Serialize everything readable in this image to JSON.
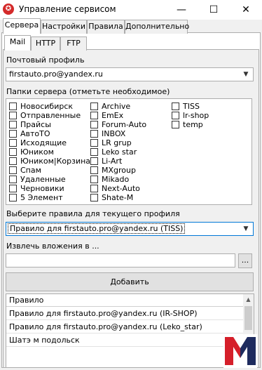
{
  "window": {
    "app_icon_glyph": "✪",
    "title": "Управление сервисом",
    "minimize_glyph": "—",
    "maximize_glyph": "☐",
    "close_glyph": "✕"
  },
  "main_tabs": [
    {
      "label": "Сервера"
    },
    {
      "label": "Настройки"
    },
    {
      "label": "Правила"
    },
    {
      "label": "Дополнительно"
    }
  ],
  "sub_tabs": [
    {
      "label": "Mail"
    },
    {
      "label": "HTTP"
    },
    {
      "label": "FTP"
    }
  ],
  "mail": {
    "profile_label": "Почтовый профиль",
    "profile_value": "firstauto.pro@yandex.ru",
    "folders_label": "Папки сервера (отметьте необходимое)",
    "folders_col1": [
      "Новосибирск",
      "Отправленные",
      "Прайсы",
      "АвтоТО",
      "Исходящие",
      "Юником",
      "Юником|Корзина",
      "Спам",
      "Удаленные",
      "Черновики",
      "5 Элемент"
    ],
    "folders_col2": [
      "Archive",
      "EmEx",
      "Forum-Auto",
      "INBOX",
      "LR grup",
      "Leko star",
      "Li-Art",
      "MXgroup",
      "Mikado",
      "Next-Auto",
      "Shate-M"
    ],
    "folders_col3": [
      "TISS",
      "lr-shop",
      "temp"
    ],
    "rule_select_label": "Выберите правила для текущего профиля",
    "rule_select_value": "Правило для firstauto.pro@yandex.ru (TISS)",
    "extract_label": "Извлечь вложения в ...",
    "extract_value": "",
    "browse_label": "...",
    "add_label": "Добавить",
    "rules_header": "Правило",
    "rules_rows": [
      "Правило для firstauto.pro@yandex.ru (IR-SHOP)",
      "Правило для firstauto.pro@yandex.ru (Leko_star)",
      "Шатэ м подольск"
    ],
    "combo_arrow_glyph": "▼",
    "scroll_up_glyph": "▲"
  },
  "logo": {
    "colors": {
      "red": "#d51f2a",
      "navy": "#1e2b5e"
    }
  }
}
